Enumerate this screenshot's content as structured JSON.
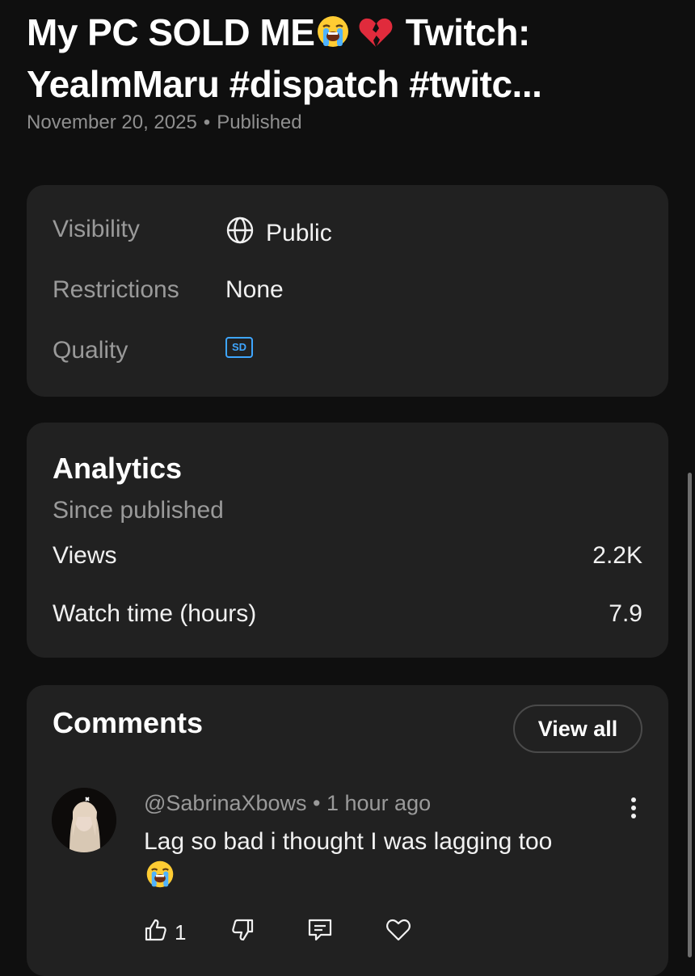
{
  "video": {
    "title_line1": "My PC SOLD ME",
    "title_line2": "YealmMaru #dispatch #twitc...",
    "title_emojis": [
      "loudly-crying-face",
      "broken-heart"
    ],
    "title_suffix": "Twitch:",
    "date": "November 20, 2025",
    "status": "Published"
  },
  "details": {
    "visibility_label": "Visibility",
    "visibility_value": "Public",
    "restrictions_label": "Restrictions",
    "restrictions_value": "None",
    "quality_label": "Quality",
    "quality_badge": "SD"
  },
  "analytics": {
    "title": "Analytics",
    "subtitle": "Since published",
    "views_label": "Views",
    "views_value": "2.2K",
    "watch_label": "Watch time (hours)",
    "watch_value": "7.9"
  },
  "comments": {
    "title": "Comments",
    "view_all": "View all",
    "items": [
      {
        "author": "@SabrinaXbows",
        "time": "1 hour ago",
        "text": "Lag so bad i thought I was lagging too",
        "emoji": "loudly-crying-face",
        "likes": "1"
      }
    ]
  },
  "colors": {
    "background": "#0f0f0f",
    "card": "#212121",
    "accent_blue": "#3ea6ff",
    "muted_text": "#9a9a9a"
  }
}
